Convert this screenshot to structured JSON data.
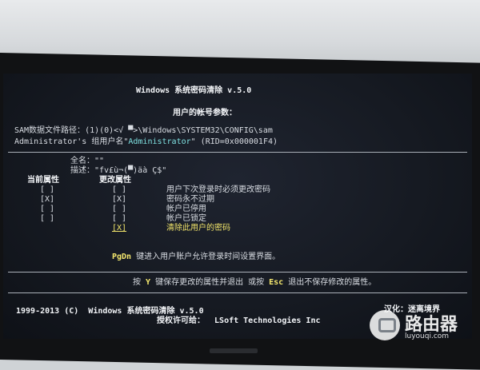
{
  "title": "Windows 系统密码清除 v.5.0",
  "subtitle": "用户的帐号参数：",
  "sam_path_label": "SAM数据文件路径：",
  "sam_path_value": "(1)(0)<√ ▀>\\Windows\\SYSTEM32\\CONFIG\\sam",
  "group_prefix": "Administrator's 组用户名\"",
  "group_user": "Administrator",
  "group_suffix": "\" (RID=0x000001F4)",
  "fullname_label": "全名：",
  "fullname_value": "\"\"",
  "desc_label": "描述：",
  "desc_value": "\"fv£ù¬(▀)äà Ç$\"",
  "current_attr_label": "当前属性",
  "change_attr_label": "更改属性",
  "attributes": [
    {
      "current": "[ ]",
      "change": "[ ]",
      "label": "用户下次登录时必须更改密码"
    },
    {
      "current": "[X]",
      "change": "[X]",
      "label": "密码永不过期"
    },
    {
      "current": "[ ]",
      "change": "[ ]",
      "label": "帐户已停用"
    },
    {
      "current": "[ ]",
      "change": "[ ]",
      "label": "帐户已锁定"
    },
    {
      "current": "",
      "change": "[X]",
      "label": "清除此用户的密码"
    }
  ],
  "pgdn_key": "PgDn",
  "pgdn_text": " 键进入用户账户允许登录时间设置界面。",
  "save_pre": "按 ",
  "save_key_y": "Y",
  "save_mid": " 键保存更改的属性并退出 或按 ",
  "save_key_esc": "Esc",
  "save_post": " 退出不保存修改的属性。",
  "copyright": "1999-2013 (C)  Windows 系统密码清除 v.5.0",
  "license": "授权许可给：  LSoft Technologies Inc",
  "localized": "汉化：迷离境界",
  "watermark_cn": "路由器",
  "watermark_en": "luyouqi.com"
}
